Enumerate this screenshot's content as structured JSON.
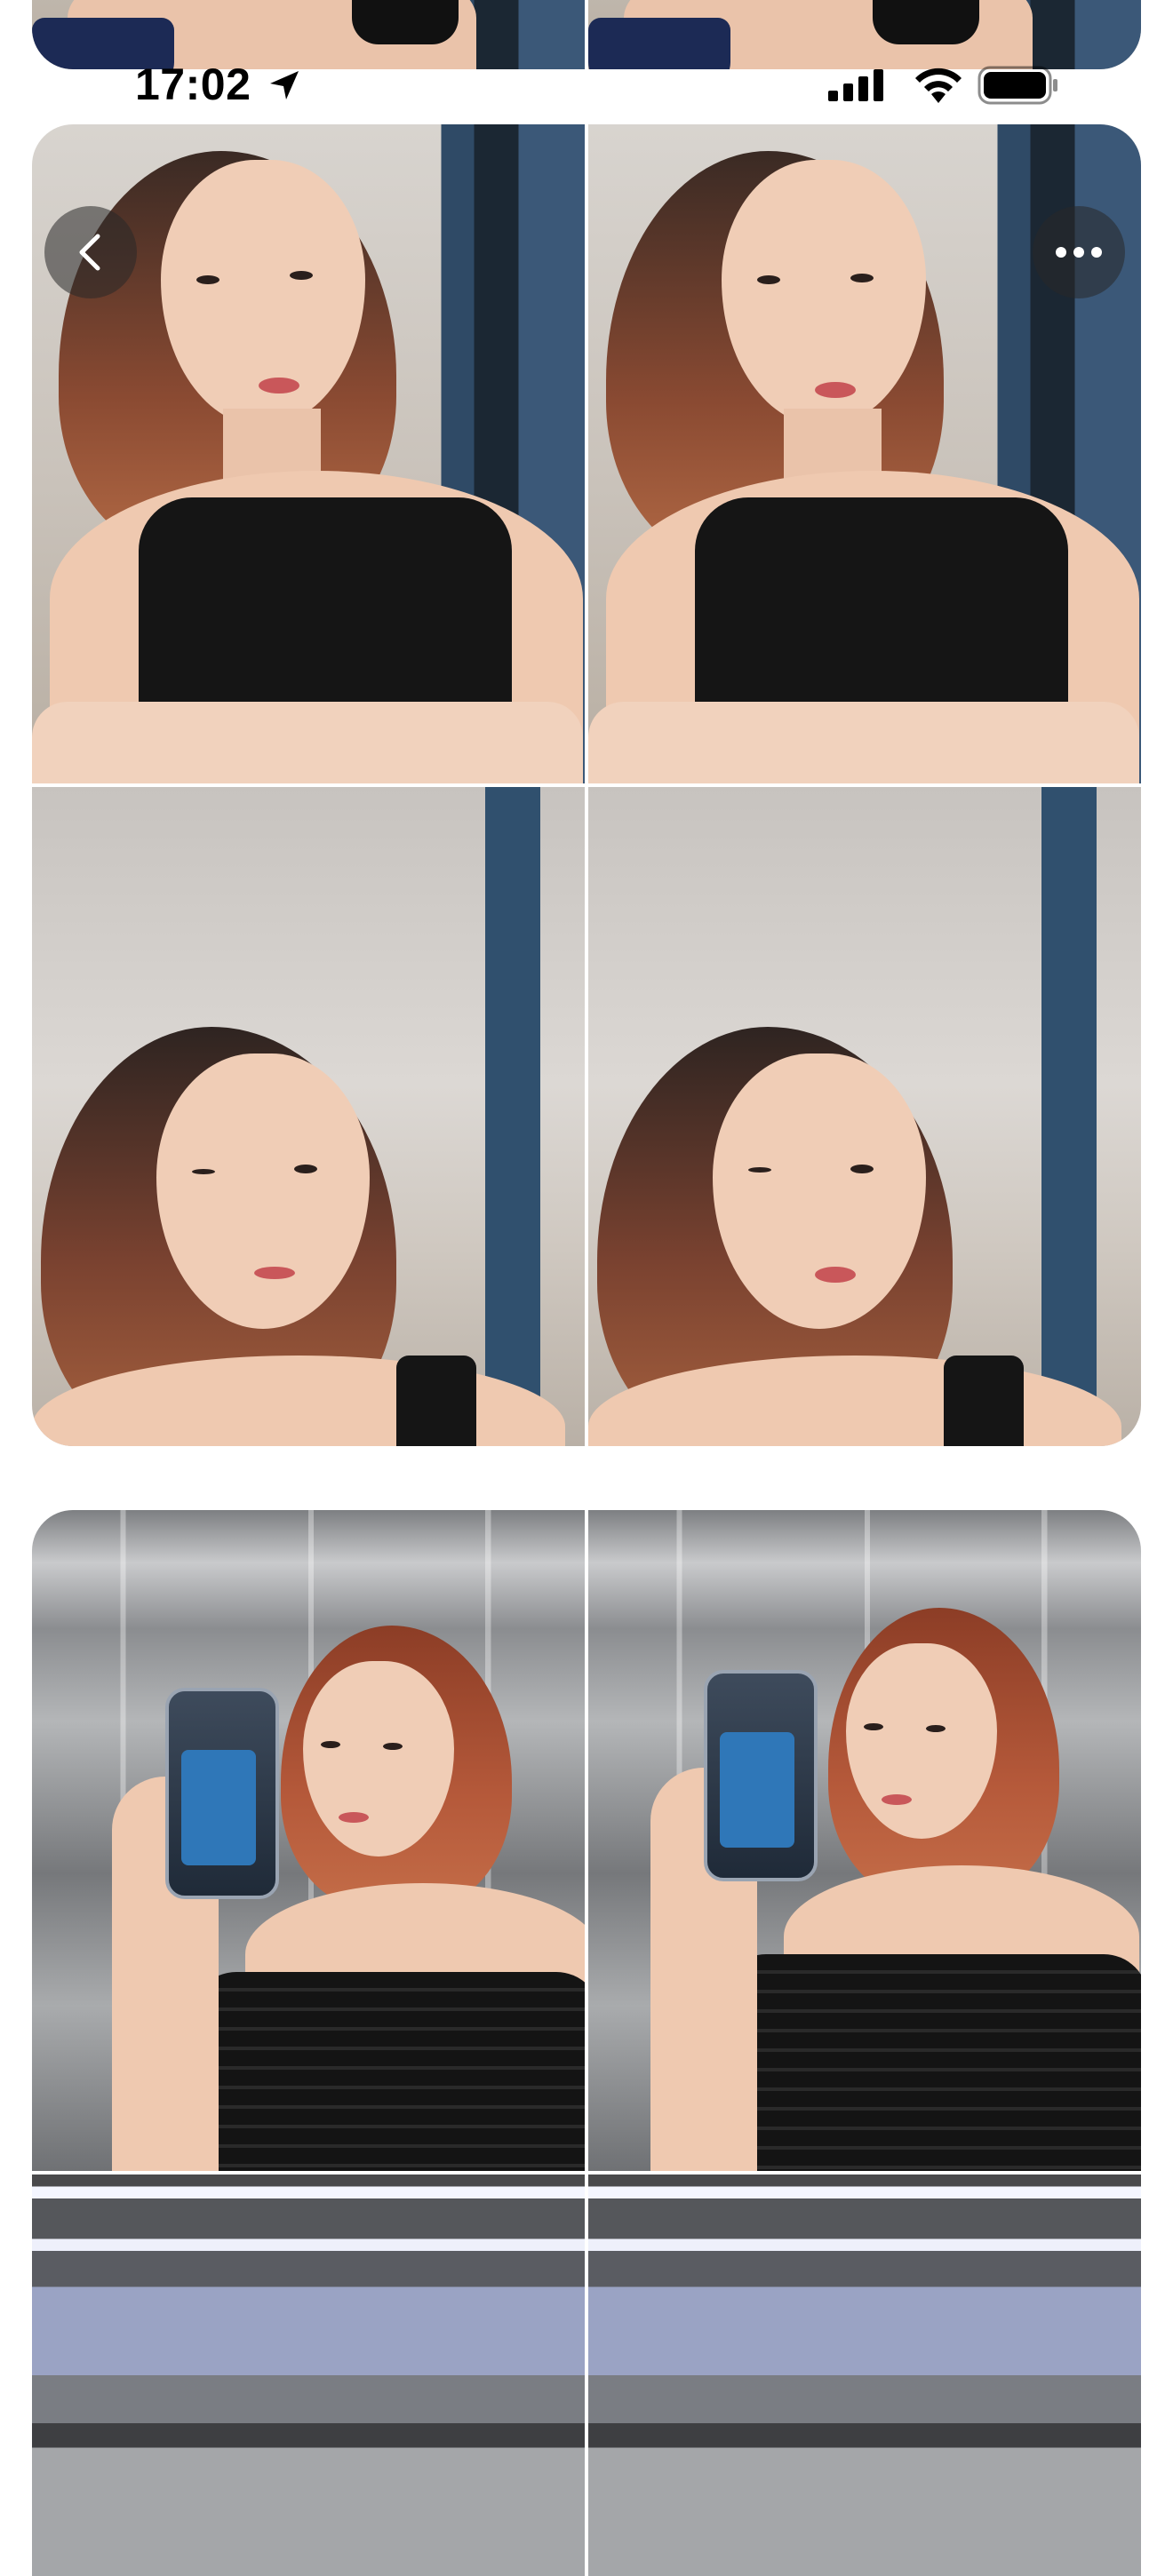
{
  "status_bar": {
    "time": "17:02",
    "icons": [
      "location-arrow-icon",
      "cellular-signal-icon",
      "wifi-icon",
      "battery-icon"
    ]
  },
  "toolbar": {
    "back_icon": "chevron-left-icon",
    "more_icon": "ellipsis-icon"
  },
  "posts": [
    {
      "name": "photo-collage-top-partial",
      "photo_count": 4
    },
    {
      "name": "photo-collage-selfie-black-top",
      "photo_count": 4
    },
    {
      "name": "photo-collage-elevator-mirror",
      "photo_count": 4
    }
  ],
  "colors": {
    "background": "#ffffff",
    "overlay_button": "#282828",
    "hair": "#8a4a32",
    "top": "#151515"
  }
}
